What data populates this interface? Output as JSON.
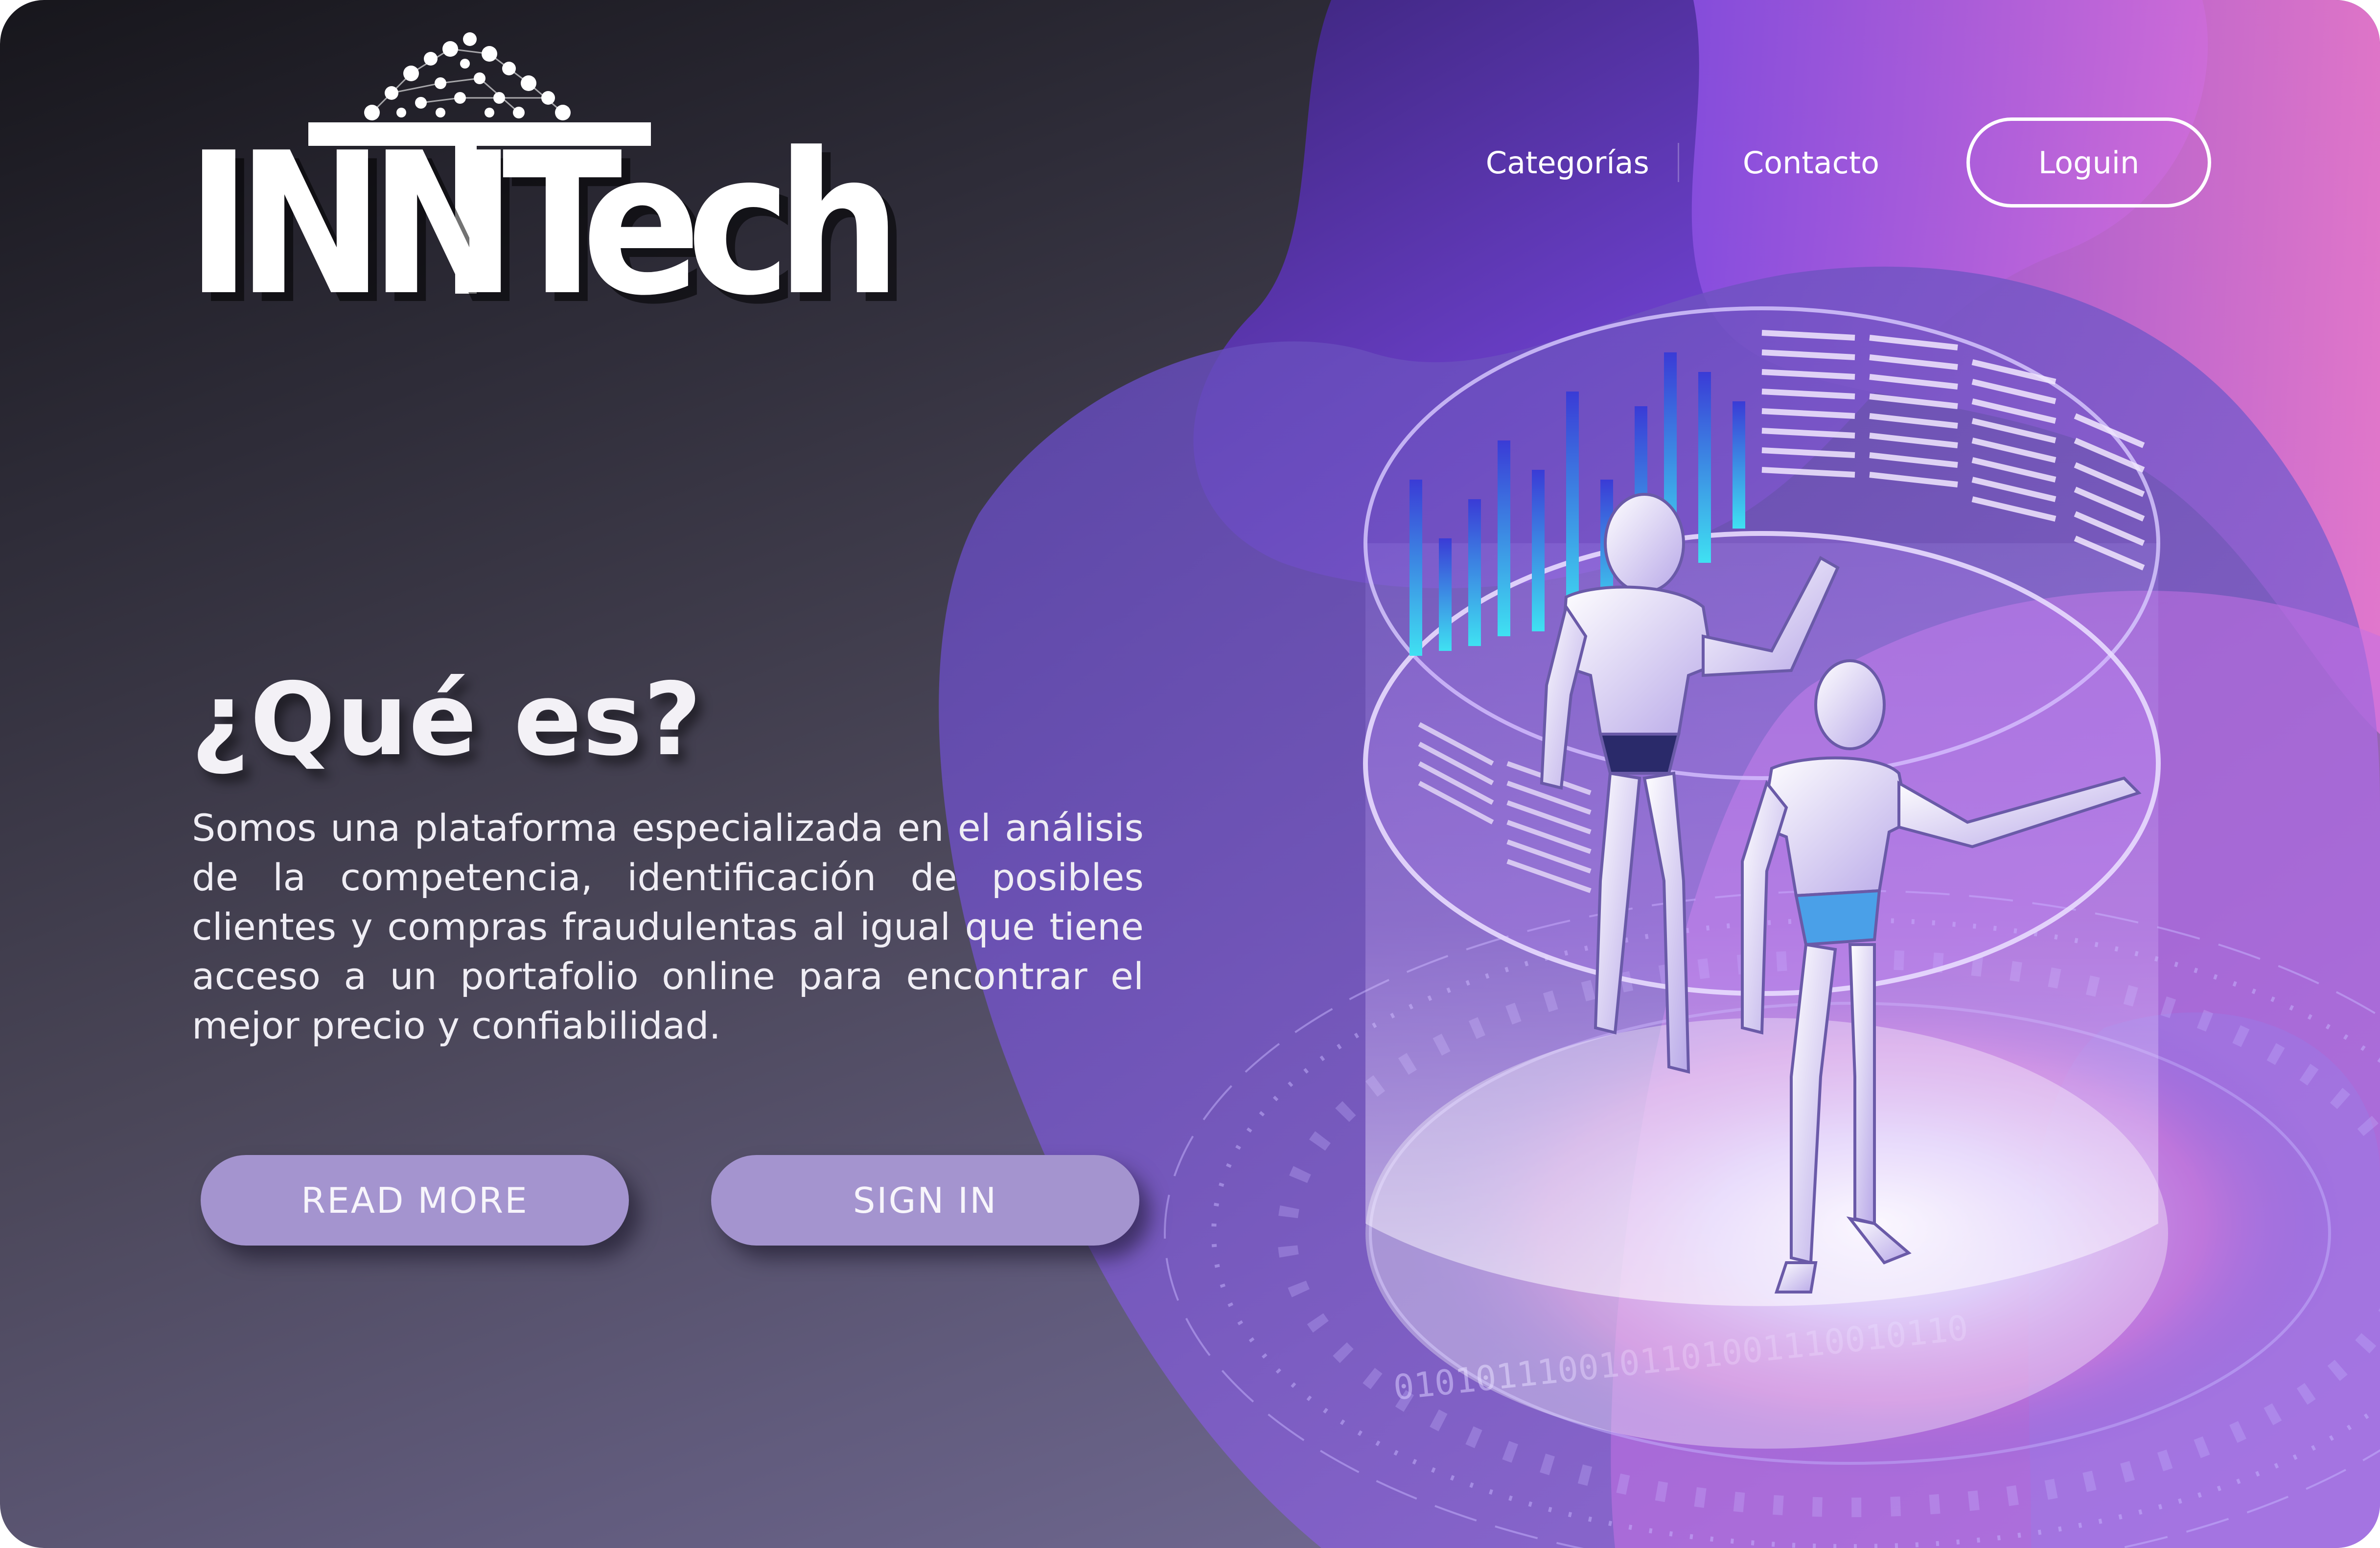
{
  "brand": {
    "logo_text": "INNTech"
  },
  "nav": {
    "items": [
      {
        "label": "Categorías"
      },
      {
        "label": "Contacto"
      }
    ],
    "login_label": "Loguin"
  },
  "hero": {
    "heading": "¿Qué es?",
    "description": "Somos una plataforma especializada en el análisis de la competencia, identificación de posibles clientes y compras fraudulentas al igual que tiene acceso a un portafolio online para encontrar el mejor precio y confiabilidad.",
    "read_more_label": "READ MORE",
    "sign_in_label": "SIGN IN"
  },
  "illustration": {
    "binary_text": "0101011100101101001110010110",
    "subject": "robots-in-hologram-cylinder"
  },
  "colors": {
    "accent_purple": "#a494cf",
    "blob_violet": "#6b3fd0",
    "blob_pink": "#e76ad9",
    "bar_cyan": "#38d2f2"
  }
}
